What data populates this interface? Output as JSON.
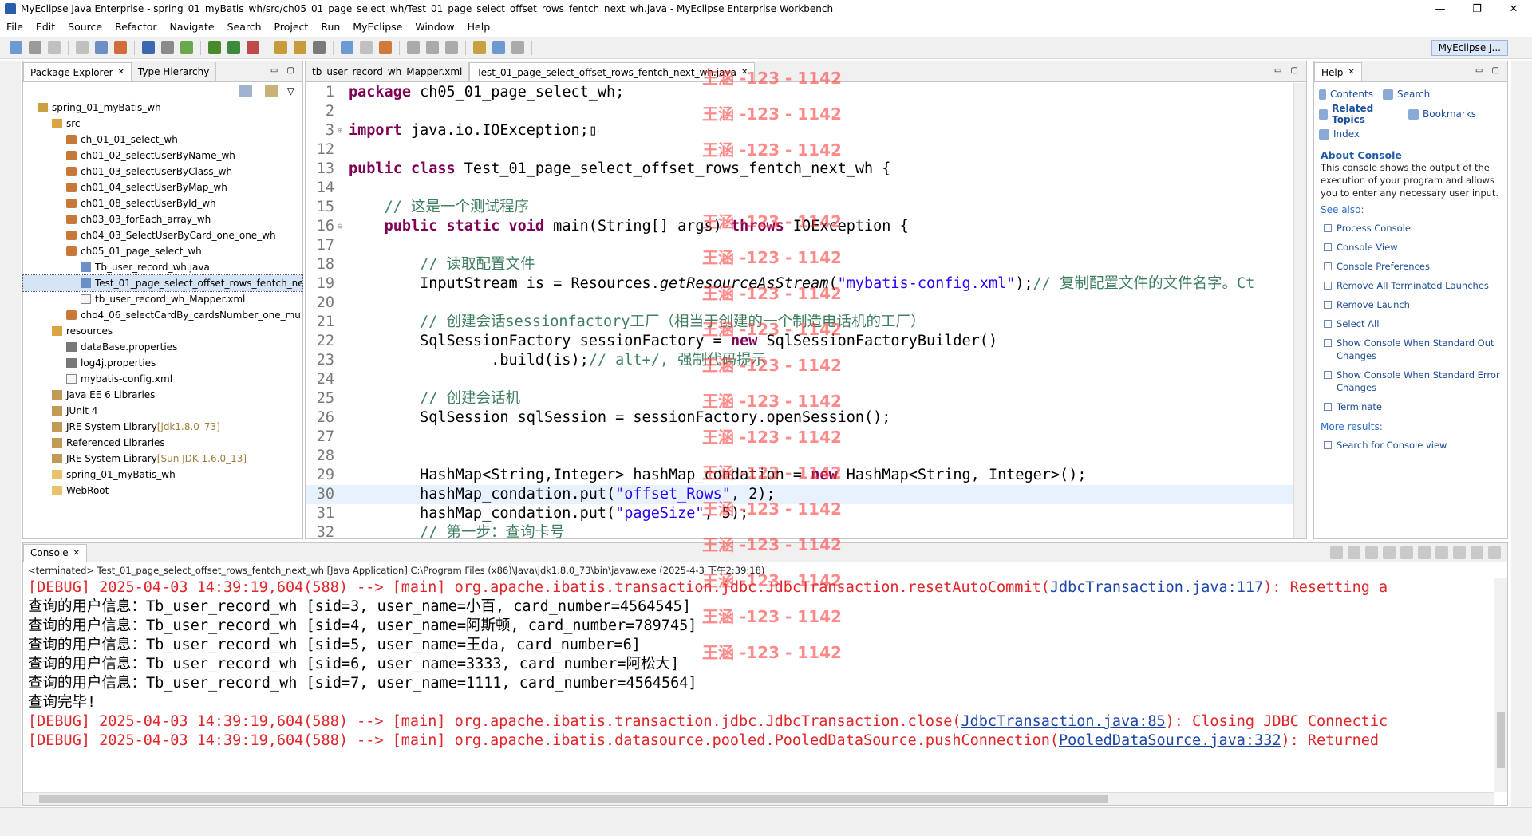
{
  "window": {
    "title": "MyEclipse Java Enterprise - spring_01_myBatis_wh/src/ch05_01_page_select_wh/Test_01_page_select_offset_rows_fentch_next_wh.java - MyEclipse Enterprise Workbench",
    "buttons": [
      "—",
      "❐",
      "✕"
    ]
  },
  "menu": [
    "File",
    "Edit",
    "Source",
    "Refactor",
    "Navigate",
    "Search",
    "Project",
    "Run",
    "MyEclipse",
    "Window",
    "Help"
  ],
  "perspective": {
    "label": "MyEclipse J..."
  },
  "explorer": {
    "tabs": [
      "Package Explorer",
      "Type Hierarchy"
    ],
    "nodes": [
      {
        "label": "spring_01_myBatis_wh",
        "indent": 1,
        "icon": "project-icon"
      },
      {
        "label": "src",
        "indent": 2,
        "icon": "source-folder-icon"
      },
      {
        "label": "ch_01_01_select_wh",
        "indent": 3,
        "icon": "package-icon"
      },
      {
        "label": "ch01_02_selectUserByName_wh",
        "indent": 3,
        "icon": "package-icon"
      },
      {
        "label": "ch01_03_selectUserByClass_wh",
        "indent": 3,
        "icon": "package-icon"
      },
      {
        "label": "ch01_04_selectUserByMap_wh",
        "indent": 3,
        "icon": "package-icon"
      },
      {
        "label": "ch01_08_selectUserById_wh",
        "indent": 3,
        "icon": "package-icon"
      },
      {
        "label": "ch03_03_forEach_array_wh",
        "indent": 3,
        "icon": "package-icon"
      },
      {
        "label": "ch04_03_SelectUserByCard_one_one_wh",
        "indent": 3,
        "icon": "package-icon"
      },
      {
        "label": "ch05_01_page_select_wh",
        "indent": 3,
        "icon": "package-icon"
      },
      {
        "label": "Tb_user_record_wh.java",
        "indent": 4,
        "icon": "java-file-icon"
      },
      {
        "label": "Test_01_page_select_offset_rows_fentch_ne",
        "indent": 4,
        "icon": "java-file-icon",
        "selected": true
      },
      {
        "label": "tb_user_record_wh_Mapper.xml",
        "indent": 4,
        "icon": "xml-file-icon"
      },
      {
        "label": "cho4_06_selectCardBy_cardsNumber_one_mu",
        "indent": 3,
        "icon": "package-icon"
      },
      {
        "label": "resources",
        "indent": 2,
        "icon": "source-folder-icon"
      },
      {
        "label": "dataBase.properties",
        "indent": 3,
        "icon": "properties-file-icon"
      },
      {
        "label": "log4j.properties",
        "indent": 3,
        "icon": "properties-file-icon"
      },
      {
        "label": "mybatis-config.xml",
        "indent": 3,
        "icon": "xml-file-icon"
      },
      {
        "label": "Java EE 6 Libraries",
        "indent": 2,
        "icon": "library-icon"
      },
      {
        "label": "JUnit 4",
        "indent": 2,
        "icon": "library-icon"
      },
      {
        "label": "JRE System Library",
        "suffix": "[jdk1.8.0_73]",
        "indent": 2,
        "icon": "library-icon"
      },
      {
        "label": "Referenced Libraries",
        "indent": 2,
        "icon": "library-icon"
      },
      {
        "label": "JRE System Library",
        "suffix": "[Sun JDK 1.6.0_13]",
        "indent": 2,
        "icon": "library-icon"
      },
      {
        "label": "spring_01_myBatis_wh",
        "indent": 2,
        "icon": "folder-icon"
      },
      {
        "label": "WebRoot",
        "indent": 2,
        "icon": "folder-icon"
      }
    ]
  },
  "editor": {
    "tabs": [
      "tb_user_record_wh_Mapper.xml",
      "Test_01_page_select_offset_rows_fentch_next_wh.java"
    ],
    "lines": [
      {
        "n": "1",
        "html": "<span class=\"kw\">package</span> ch05_01_page_select_wh;"
      },
      {
        "n": "2",
        "html": ""
      },
      {
        "n": "3",
        "html": "<span class=\"kw\">import</span> java.io.IOException;▯",
        "marker": "⊕"
      },
      {
        "n": "12",
        "html": ""
      },
      {
        "n": "13",
        "html": "<span class=\"kw\">public class</span> Test_01_page_select_offset_rows_fentch_next_wh {"
      },
      {
        "n": "14",
        "html": ""
      },
      {
        "n": "15",
        "html": "    <span class=\"cm\">// 这是一个测试程序</span>"
      },
      {
        "n": "16",
        "html": "    <span class=\"kw\">public static void</span> main(String[] args) <span class=\"kw\">throws</span> IOException {",
        "marker": "⊖"
      },
      {
        "n": "17",
        "html": ""
      },
      {
        "n": "18",
        "html": "        <span class=\"cm\">// 读取配置文件</span>"
      },
      {
        "n": "19",
        "html": "        InputStream is = Resources.<span class=\"it\">getResourceAsStream</span>(<span class=\"str\">\"mybatis-config.xml\"</span>);<span class=\"cm\">// 复制配置文件的文件名字。Ct</span>"
      },
      {
        "n": "20",
        "html": ""
      },
      {
        "n": "21",
        "html": "        <span class=\"cm\">// 创建会话sessionfactory工厂（相当于创建的一个制造电话机的工厂）</span>"
      },
      {
        "n": "22",
        "html": "        SqlSessionFactory sessionFactory = <span class=\"kw\">new</span> SqlSessionFactoryBuilder()"
      },
      {
        "n": "23",
        "html": "                .build(is);<span class=\"cm\">// alt+/, 强制代码提示</span>"
      },
      {
        "n": "24",
        "html": ""
      },
      {
        "n": "25",
        "html": "        <span class=\"cm\">// 创建会话机</span>"
      },
      {
        "n": "26",
        "html": "        SqlSession sqlSession = sessionFactory.openSession();"
      },
      {
        "n": "27",
        "html": ""
      },
      {
        "n": "28",
        "html": ""
      },
      {
        "n": "29",
        "html": "        HashMap&lt;String,Integer&gt; hashMap_condation = <span class=\"kw\">new</span> HashMap&lt;String, Integer&gt;();"
      },
      {
        "n": "30",
        "html": "        hashMap_condation.put(<span class=\"str\">\"offset_Rows\"</span>, 2);",
        "current": true
      },
      {
        "n": "31",
        "html": "        hashMap_condation.put(<span class=\"str\">\"pageSize\"</span>, 5);"
      },
      {
        "n": "32",
        "html": "        <span class=\"cm\">// 第一步：查询卡号</span>"
      }
    ]
  },
  "help": {
    "tab": "Help",
    "nav": [
      "Contents",
      "Search",
      "Related Topics",
      "Bookmarks",
      "Index"
    ],
    "heading": "About Console",
    "description": "This console shows the output of the execution of your program and allows you to enter any necessary user input.",
    "see_also": "See also:",
    "links": [
      "Process Console",
      "Console View",
      "Console Preferences",
      "Remove All Terminated Launches",
      "Remove Launch",
      "Select All",
      "Show Console When Standard Out Changes",
      "Show Console When Standard Error Changes",
      "Terminate"
    ],
    "more_results": "More results:",
    "search_link": "Search for Console view"
  },
  "console": {
    "tab": "Console",
    "terminated": "<terminated> Test_01_page_select_offset_rows_fentch_next_wh [Java Application] C:\\Program Files (x86)\\Java\\jdk1.8.0_73\\bin\\javaw.exe (2025-4-3 下午2:39:18)",
    "lines": [
      {
        "type": "err",
        "text": "[DEBUG] 2025-04-03 14:39:19,604(588) --> [main] org.apache.ibatis.transaction.jdbc.JdbcTransaction.resetAutoCommit(",
        "link": "JdbcTransaction.java:117",
        "after": "): Resetting a"
      },
      {
        "type": "out",
        "text": "查询的用户信息：Tb_user_record_wh [sid=3, user_name=小百, card_number=4564545]"
      },
      {
        "type": "out",
        "text": "查询的用户信息：Tb_user_record_wh [sid=4, user_name=阿斯顿, card_number=789745]"
      },
      {
        "type": "out",
        "text": "查询的用户信息：Tb_user_record_wh [sid=5, user_name=王da, card_number=6]"
      },
      {
        "type": "out",
        "text": "查询的用户信息：Tb_user_record_wh [sid=6, user_name=3333, card_number=阿松大]"
      },
      {
        "type": "out",
        "text": "查询的用户信息：Tb_user_record_wh [sid=7, user_name=1111, card_number=4564564]"
      },
      {
        "type": "out",
        "text": "查询完毕!"
      },
      {
        "type": "err",
        "text": "[DEBUG] 2025-04-03 14:39:19,604(588) --> [main] org.apache.ibatis.transaction.jdbc.JdbcTransaction.close(",
        "link": "JdbcTransaction.java:85",
        "after": "): Closing JDBC Connectic"
      },
      {
        "type": "err",
        "text": "[DEBUG] 2025-04-03 14:39:19,604(588) --> [main] org.apache.ibatis.datasource.pooled.PooledDataSource.pushConnection(",
        "link": "PooledDataSource.java:332",
        "after": "): Returned"
      }
    ]
  },
  "watermark": "王涵 -123 - 1142"
}
